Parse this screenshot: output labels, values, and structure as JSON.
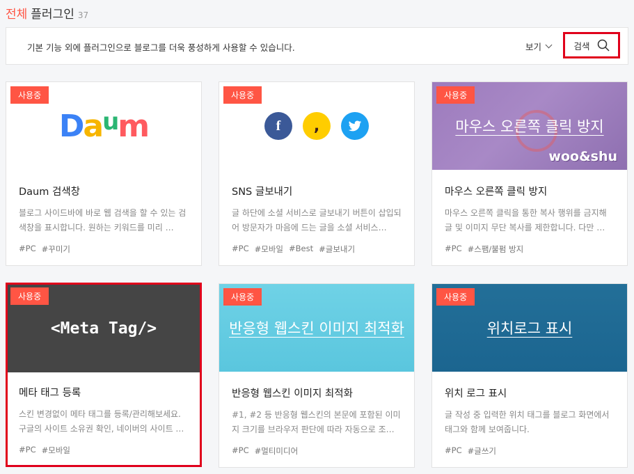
{
  "header": {
    "accent": "전체",
    "title": "플러그인",
    "count": "37"
  },
  "infobar": {
    "description": "기본 기능 외에 플러그인으로 블로그를 더욱 풍성하게 사용할 수 있습니다.",
    "view_label": "보기",
    "search_label": "검색"
  },
  "badge_label": "사용중",
  "cards": [
    {
      "thumb_logo": [
        "D",
        "a",
        "u",
        "m"
      ],
      "title": "Daum 검색창",
      "desc": "블로그 사이드바에 바로 웹 검색을 할 수 있는 검색창을 표시합니다. 원하는 키워드를 미리 …",
      "tags": [
        "#PC",
        "#꾸미기"
      ]
    },
    {
      "thumb_icons": [
        "facebook-icon",
        "kakaostory-icon",
        "twitter-icon"
      ],
      "title": "SNS 글보내기",
      "desc": "글 하단에 소셜 서비스로 글보내기 버튼이 삽입되어 방문자가 마음에 드는 글을 소셜 서비스…",
      "tags": [
        "#PC",
        "#모바일",
        "#Best",
        "#글보내기"
      ]
    },
    {
      "thumb_text": "마우스 오른쪽 클릭 방지",
      "thumb_watermark": "woo&shu",
      "title": "마우스 오른쪽 클릭 방지",
      "desc": "마우스 오른쪽 클릭을 통한 복사 행위를 금지해 글 및 이미지 무단 복사를 제한합니다. 다만 …",
      "tags": [
        "#PC",
        "#스팸/불펌 방지"
      ]
    },
    {
      "thumb_text": "<Meta Tag/>",
      "title": "메타 태그 등록",
      "desc": "스킨 변경없이 메타 태그를 등록/관리해보세요. 구글의 사이트 소유권 확인, 네이버의 사이트 …",
      "tags": [
        "#PC",
        "#모바일"
      ]
    },
    {
      "thumb_text": "반응형 웹스킨 이미지 최적화",
      "title": "반응형 웹스킨 이미지 최적화",
      "desc": "#1, #2 등 반응형 웹스킨의 본문에 포함된 이미지 크기를 브라우저 판단에 따라 자동으로 조…",
      "tags": [
        "#PC",
        "#멀티미디어"
      ]
    },
    {
      "thumb_text": "위치로그 표시",
      "title": "위치 로그 표시",
      "desc": "글 작성 중 입력한 위치 태그를 블로그 화면에서 태그와 함께 보여줍니다.",
      "tags": [
        "#PC",
        "#글쓰기"
      ]
    }
  ],
  "colors": {
    "accent": "#ff5544",
    "highlight_border": "#e0001b",
    "thumb_purple": "#a07cc0",
    "thumb_dark": "#454545",
    "thumb_cyan": "#5ec9e0",
    "thumb_blue": "#1f6f96"
  }
}
